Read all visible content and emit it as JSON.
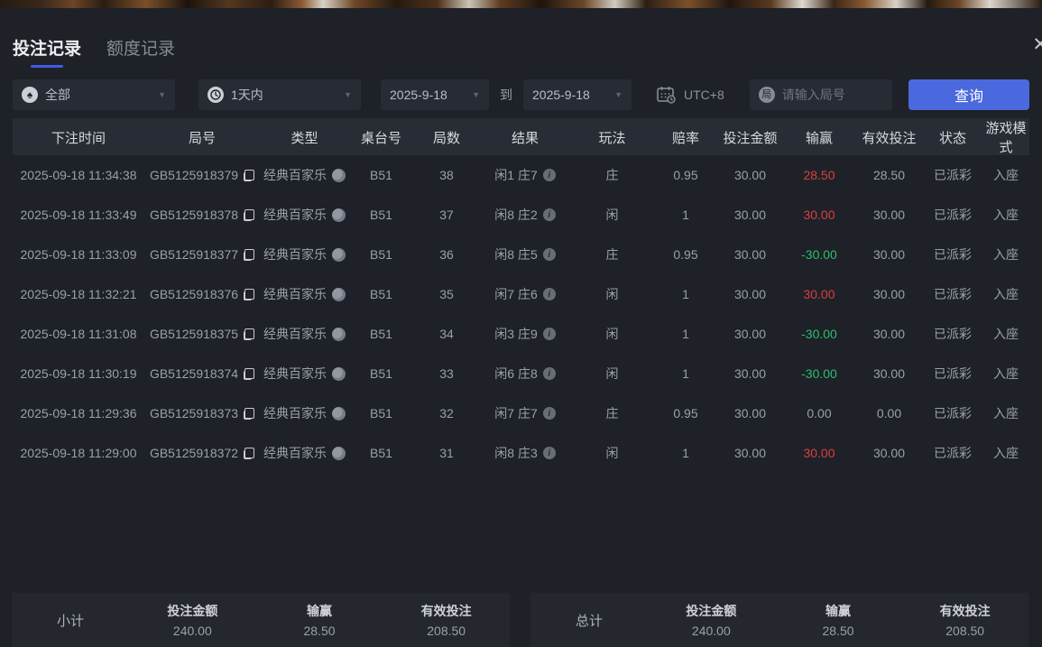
{
  "tabs": [
    {
      "label": "投注记录",
      "active": true
    },
    {
      "label": "额度记录",
      "active": false
    }
  ],
  "close_glyph": "✕",
  "icons": {
    "spade": "♠",
    "round_char": "局",
    "info": "i",
    "dropdown_arrow": "▼"
  },
  "filters": {
    "game_type_value": "全部",
    "time_range_value": "1天内",
    "date_from": "2025-9-18",
    "to_label": "到",
    "date_to": "2025-9-18",
    "timezone": "UTC+8",
    "round_placeholder": "请输入局号",
    "query_label": "查询"
  },
  "table": {
    "columns": [
      "下注时间",
      "局号",
      "类型",
      "桌台号",
      "局数",
      "结果",
      "玩法",
      "赔率",
      "投注金额",
      "输赢",
      "有效投注",
      "状态",
      "游戏模式"
    ],
    "rows": [
      {
        "time": "2025-09-18 11:34:38",
        "round_id": "GB5125918379",
        "game_type": "经典百家乐",
        "table_no": "B51",
        "round_no": "38",
        "result": "闲1 庄7",
        "play": "庄",
        "odds": "0.95",
        "bet_amount": "30.00",
        "win_loss": "28.50",
        "win_class": "red",
        "valid_bet": "28.50",
        "status": "已派彩",
        "mode": "入座"
      },
      {
        "time": "2025-09-18 11:33:49",
        "round_id": "GB5125918378",
        "game_type": "经典百家乐",
        "table_no": "B51",
        "round_no": "37",
        "result": "闲8 庄2",
        "play": "闲",
        "odds": "1",
        "bet_amount": "30.00",
        "win_loss": "30.00",
        "win_class": "red",
        "valid_bet": "30.00",
        "status": "已派彩",
        "mode": "入座"
      },
      {
        "time": "2025-09-18 11:33:09",
        "round_id": "GB5125918377",
        "game_type": "经典百家乐",
        "table_no": "B51",
        "round_no": "36",
        "result": "闲8 庄5",
        "play": "庄",
        "odds": "0.95",
        "bet_amount": "30.00",
        "win_loss": "-30.00",
        "win_class": "green",
        "valid_bet": "30.00",
        "status": "已派彩",
        "mode": "入座"
      },
      {
        "time": "2025-09-18 11:32:21",
        "round_id": "GB5125918376",
        "game_type": "经典百家乐",
        "table_no": "B51",
        "round_no": "35",
        "result": "闲7 庄6",
        "play": "闲",
        "odds": "1",
        "bet_amount": "30.00",
        "win_loss": "30.00",
        "win_class": "red",
        "valid_bet": "30.00",
        "status": "已派彩",
        "mode": "入座"
      },
      {
        "time": "2025-09-18 11:31:08",
        "round_id": "GB5125918375",
        "game_type": "经典百家乐",
        "table_no": "B51",
        "round_no": "34",
        "result": "闲3 庄9",
        "play": "闲",
        "odds": "1",
        "bet_amount": "30.00",
        "win_loss": "-30.00",
        "win_class": "green",
        "valid_bet": "30.00",
        "status": "已派彩",
        "mode": "入座"
      },
      {
        "time": "2025-09-18 11:30:19",
        "round_id": "GB5125918374",
        "game_type": "经典百家乐",
        "table_no": "B51",
        "round_no": "33",
        "result": "闲6 庄8",
        "play": "闲",
        "odds": "1",
        "bet_amount": "30.00",
        "win_loss": "-30.00",
        "win_class": "green",
        "valid_bet": "30.00",
        "status": "已派彩",
        "mode": "入座"
      },
      {
        "time": "2025-09-18 11:29:36",
        "round_id": "GB5125918373",
        "game_type": "经典百家乐",
        "table_no": "B51",
        "round_no": "32",
        "result": "闲7 庄7",
        "play": "庄",
        "odds": "0.95",
        "bet_amount": "30.00",
        "win_loss": "0.00",
        "win_class": "neutral",
        "valid_bet": "0.00",
        "status": "已派彩",
        "mode": "入座"
      },
      {
        "time": "2025-09-18 11:29:00",
        "round_id": "GB5125918372",
        "game_type": "经典百家乐",
        "table_no": "B51",
        "round_no": "31",
        "result": "闲8 庄3",
        "play": "闲",
        "odds": "1",
        "bet_amount": "30.00",
        "win_loss": "30.00",
        "win_class": "red",
        "valid_bet": "30.00",
        "status": "已派彩",
        "mode": "入座"
      }
    ]
  },
  "summary": {
    "subtotal": {
      "label": "小计",
      "bet_amount_label": "投注金额",
      "bet_amount": "240.00",
      "win_loss_label": "输赢",
      "win_loss": "28.50",
      "valid_bet_label": "有效投注",
      "valid_bet": "208.50"
    },
    "total": {
      "label": "总计",
      "bet_amount_label": "投注金额",
      "bet_amount": "240.00",
      "win_loss_label": "输赢",
      "win_loss": "28.50",
      "valid_bet_label": "有效投注",
      "valid_bet": "208.50"
    }
  },
  "colors": {
    "accent_blue": "#4a69de",
    "win_red": "#d94040",
    "loss_green": "#2bbf6e",
    "panel_bg": "#1e2127"
  }
}
